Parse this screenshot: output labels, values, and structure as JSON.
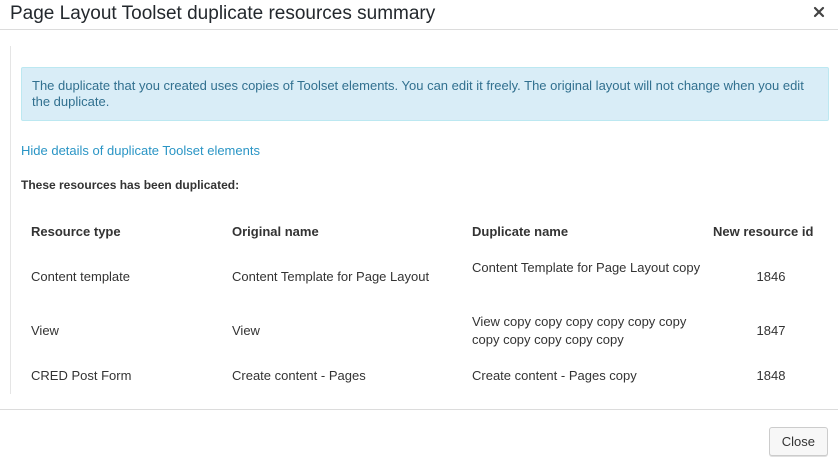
{
  "dialog": {
    "title": "Page Layout Toolset duplicate resources summary"
  },
  "notice": {
    "text": "The duplicate that you created uses copies of Toolset elements. You can edit it freely. The original layout will not change when you edit the duplicate."
  },
  "details_link": "Hide details of duplicate Toolset elements",
  "section_heading": "These resources has been duplicated:",
  "table": {
    "headers": {
      "type": "Resource type",
      "original": "Original name",
      "duplicate": "Duplicate name",
      "id": "New resource id"
    },
    "rows": [
      {
        "type": "Content template",
        "original": "Content Template for Page Layout",
        "duplicate": "Content Template for Page Layout copy",
        "id": "1846"
      },
      {
        "type": "View",
        "original": "View",
        "duplicate": "View copy copy copy copy copy copy copy copy copy copy copy",
        "id": "1847"
      },
      {
        "type": "CRED Post Form",
        "original": "Create content - Pages",
        "duplicate": "Create content - Pages copy",
        "id": "1848"
      }
    ]
  },
  "footer": {
    "close_label": "Close"
  },
  "icons": {
    "close": "close-icon"
  },
  "colors": {
    "notice_bg": "#d9edf7",
    "notice_text": "#31708f",
    "link": "#2a95c5"
  }
}
